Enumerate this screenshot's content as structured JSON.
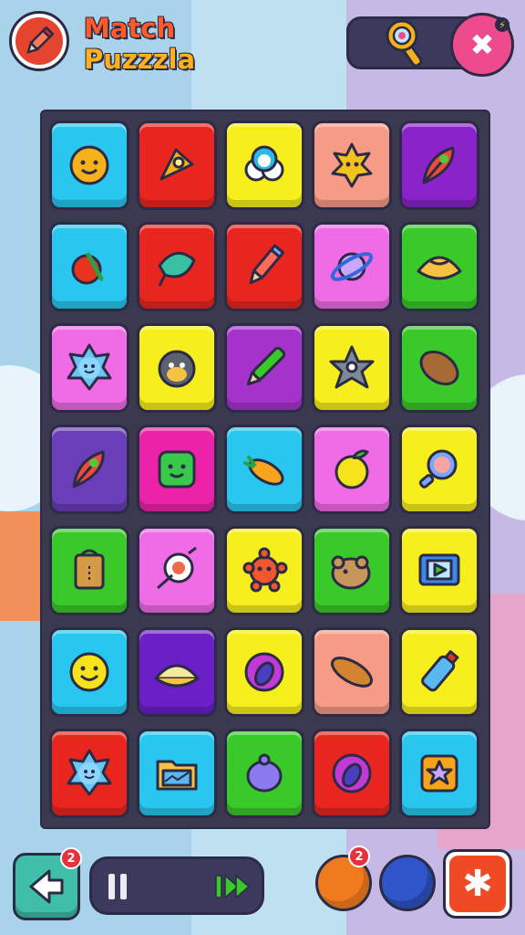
{
  "header": {
    "title_line1": "Match",
    "title_line2": "Puzzzla",
    "pencil_icon": "pencil-icon",
    "magnify_icon": "magnifier-icon",
    "close_icon": "close-icon"
  },
  "board": {
    "rows": 7,
    "cols": 5,
    "tiles": [
      {
        "color": "#29c6ef",
        "icon": "smiley-sun-icon"
      },
      {
        "color": "#e8261f",
        "icon": "rocket-icon"
      },
      {
        "color": "#f7ef1d",
        "icon": "cloud-face-icon"
      },
      {
        "color": "#f59b86",
        "icon": "sun-face-icon"
      },
      {
        "color": "#8a23c9",
        "icon": "feather-icon"
      },
      {
        "color": "#29c6ef",
        "icon": "apple-icon"
      },
      {
        "color": "#e8261f",
        "icon": "leaf-icon"
      },
      {
        "color": "#e8261f",
        "icon": "pencil-icon"
      },
      {
        "color": "#f06be6",
        "icon": "planet-icon"
      },
      {
        "color": "#39c929",
        "icon": "dumpling-icon"
      },
      {
        "color": "#f06be6",
        "icon": "flower-face-icon"
      },
      {
        "color": "#f7ef1d",
        "icon": "monkey-icon"
      },
      {
        "color": "#a632cc",
        "icon": "marker-icon"
      },
      {
        "color": "#f7ef1d",
        "icon": "starfish-icon"
      },
      {
        "color": "#39c929",
        "icon": "potato-icon"
      },
      {
        "color": "#6a3eb8",
        "icon": "feather-icon"
      },
      {
        "color": "#ec22a8",
        "icon": "green-cube-face-icon"
      },
      {
        "color": "#29c6ef",
        "icon": "carrot-icon"
      },
      {
        "color": "#f06be6",
        "icon": "lemon-icon"
      },
      {
        "color": "#f7ef1d",
        "icon": "mirror-icon"
      },
      {
        "color": "#39c929",
        "icon": "bag-icon"
      },
      {
        "color": "#f06be6",
        "icon": "compass-icon"
      },
      {
        "color": "#f7ef1d",
        "icon": "germ-icon"
      },
      {
        "color": "#39c929",
        "icon": "hamster-icon"
      },
      {
        "color": "#f7ef1d",
        "icon": "video-player-icon"
      },
      {
        "color": "#29c6ef",
        "icon": "smiley-icon"
      },
      {
        "color": "#6a1fc7",
        "icon": "bun-icon"
      },
      {
        "color": "#f7ef1d",
        "icon": "eggplant-icon"
      },
      {
        "color": "#f59b86",
        "icon": "bread-icon"
      },
      {
        "color": "#f7ef1d",
        "icon": "bottle-icon"
      },
      {
        "color": "#e8261f",
        "icon": "flower-face-icon"
      },
      {
        "color": "#29c6ef",
        "icon": "folder-chart-icon"
      },
      {
        "color": "#39c929",
        "icon": "blob-icon"
      },
      {
        "color": "#e8261f",
        "icon": "eggplant-icon"
      },
      {
        "color": "#29c6ef",
        "icon": "star-box-icon"
      }
    ]
  },
  "footer": {
    "back_badge": "2",
    "orange_badge": "2",
    "back_icon": "back-arrow-icon",
    "pause_icon": "pause-icon",
    "fast_forward_icon": "fast-forward-icon",
    "star_icon": "asterisk-icon",
    "star_glyph": "✱"
  }
}
